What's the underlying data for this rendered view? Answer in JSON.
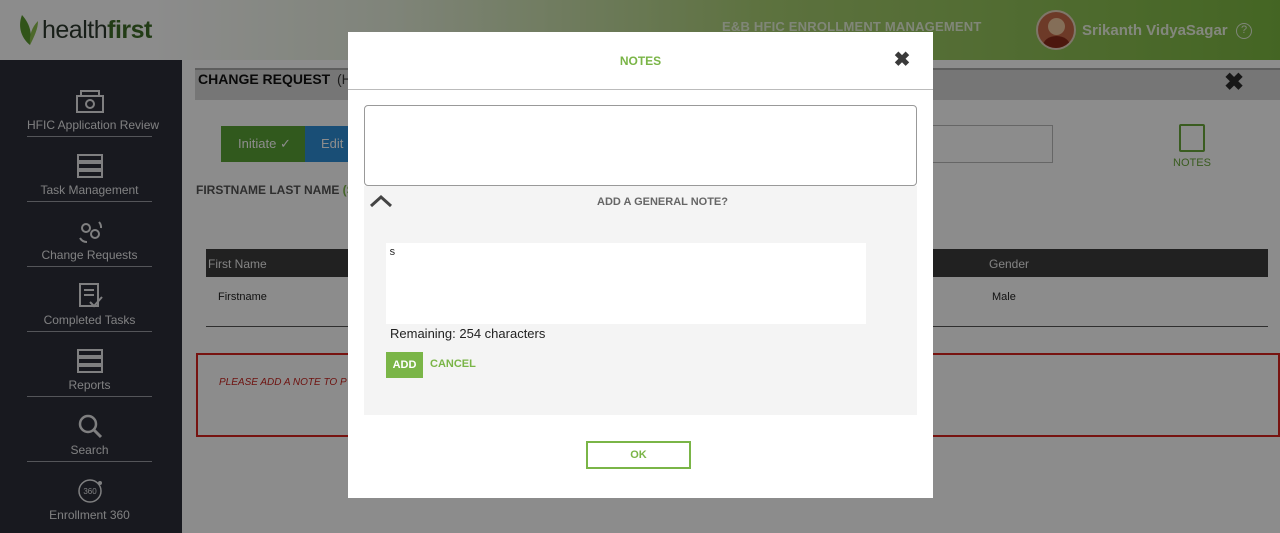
{
  "header": {
    "logo": {
      "brand_light": "health",
      "brand_bold": "first"
    },
    "app_title": "E&B HFIC ENROLLMENT MANAGEMENT",
    "user_name": "Srikanth VidyaSagar",
    "help": "?"
  },
  "sidebar": {
    "items": [
      {
        "label": "HFIC Application Review",
        "icon": "application-review-icon"
      },
      {
        "label": "Task Management",
        "icon": "task-management-icon"
      },
      {
        "label": "Change Requests",
        "icon": "change-requests-icon"
      },
      {
        "label": "Completed Tasks",
        "icon": "completed-tasks-icon"
      },
      {
        "label": "Reports",
        "icon": "reports-icon"
      },
      {
        "label": "Search",
        "icon": "search-icon"
      },
      {
        "label": "Enrollment 360",
        "icon": "enrollment-360-icon"
      }
    ]
  },
  "main": {
    "title": "CHANGE REQUEST",
    "subtitle_fragment": "(H",
    "steps": {
      "initiate": "Initiate",
      "edit": "Edit"
    },
    "member_name": "FIRSTNAME LAST NAME",
    "member_status_fragment": "(SU",
    "notes_label": "NOTES",
    "table": {
      "headers": {
        "first_name": "First Name",
        "gender": "Gender"
      },
      "row": {
        "first_name": "Firstname",
        "gender": "Male"
      }
    },
    "error_fragment": "PLEASE ADD A NOTE TO P"
  },
  "modal": {
    "title": "NOTES",
    "panel_title": "ADD A GENERAL NOTE?",
    "note_value": "s",
    "remaining": "Remaining: 254 characters",
    "add_label": "ADD",
    "cancel_label": "CANCEL",
    "ok_label": "OK"
  },
  "colors": {
    "accent": "#7ab547",
    "sidebar": "#2c2f3a",
    "error": "#d9241e"
  }
}
